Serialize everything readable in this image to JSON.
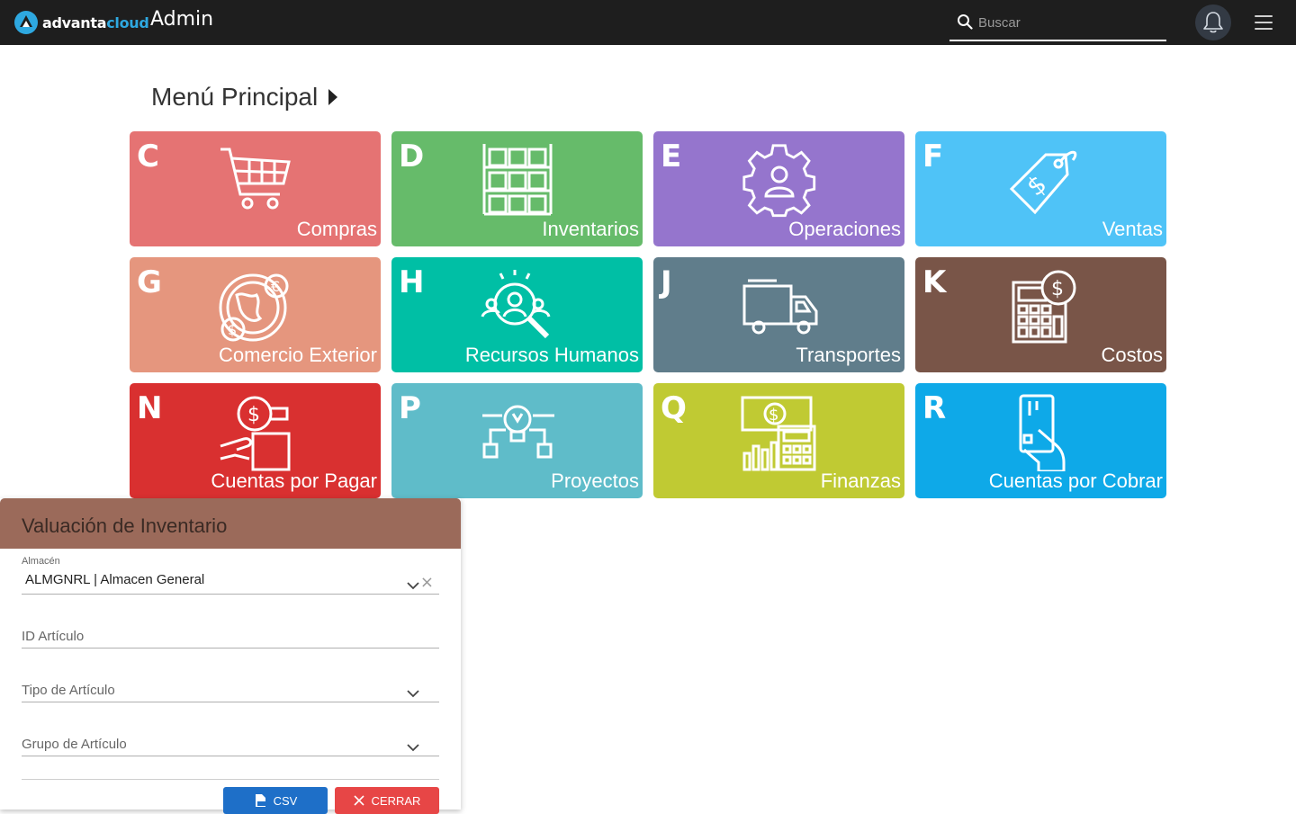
{
  "app": {
    "brand_main": "advanta",
    "brand_accent": "cloud",
    "title": "Admin"
  },
  "search": {
    "placeholder": "Buscar"
  },
  "page": {
    "title": "Menú Principal"
  },
  "tiles": [
    {
      "letter": "C",
      "label": "Compras",
      "color": "#e57373",
      "icon": "shopping-cart-icon"
    },
    {
      "letter": "D",
      "label": "Inventarios",
      "color": "#66bb6a",
      "icon": "warehouse-boxes-icon"
    },
    {
      "letter": "E",
      "label": "Operaciones",
      "color": "#9575cd",
      "icon": "gear-user-icon"
    },
    {
      "letter": "F",
      "label": "Ventas",
      "color": "#4fc3f7",
      "icon": "price-tag-icon"
    },
    {
      "letter": "G",
      "label": "Comercio Exterior",
      "color": "#e5967e",
      "icon": "globe-currency-icon"
    },
    {
      "letter": "H",
      "label": "Recursos Humanos",
      "color": "#00bfa5",
      "icon": "people-search-icon"
    },
    {
      "letter": "J",
      "label": "Transportes",
      "color": "#607d8b",
      "icon": "truck-icon"
    },
    {
      "letter": "K",
      "label": "Costos",
      "color": "#795548",
      "icon": "calculator-dollar-icon"
    },
    {
      "letter": "N",
      "label": "Cuentas por Pagar",
      "color": "#d93030",
      "icon": "hand-dollar-icon"
    },
    {
      "letter": "P",
      "label": "Proyectos",
      "color": "#5fbcc9",
      "icon": "lightbulb-project-icon"
    },
    {
      "letter": "Q",
      "label": "Finanzas",
      "color": "#c0ca33",
      "icon": "finance-calculator-icon"
    },
    {
      "letter": "R",
      "label": "Cuentas por Cobrar",
      "color": "#0ea9e8",
      "icon": "hand-card-icon"
    }
  ],
  "panel": {
    "title": "Valuación de Inventario",
    "almacen_label": "Almacén",
    "almacen_value": "ALMGNRL | Almacen General",
    "id_articulo_placeholder": "ID Artículo",
    "tipo_articulo_placeholder": "Tipo de Artículo",
    "grupo_articulo_placeholder": "Grupo de Artículo",
    "csv_label": "CSV",
    "close_label": "CERRAR"
  },
  "colors": {
    "topbar": "#1e1e1e",
    "panel_header": "#9b6a5a",
    "csv_button": "#1e6fc8",
    "close_button": "#e74646"
  }
}
